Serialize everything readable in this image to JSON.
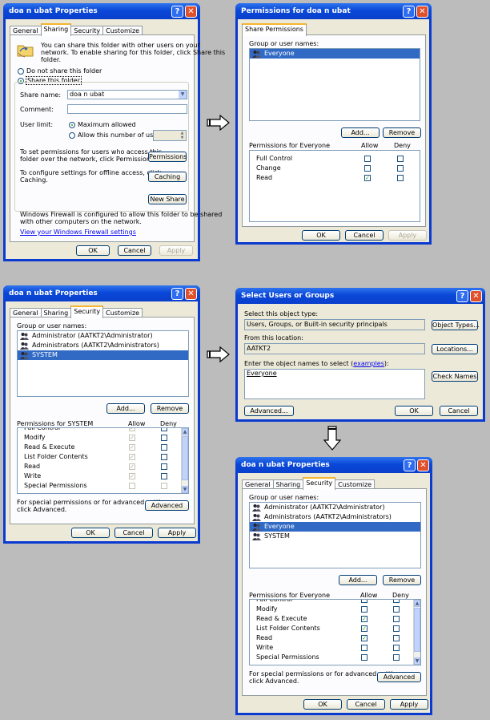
{
  "colors": {
    "title_bar": "#0a48d8",
    "dialog_bg": "#ece9d8",
    "selection": "#316ac5",
    "check": "#21a121",
    "desktop": "#bcbcbc"
  },
  "icons": [
    "help-icon",
    "close-icon",
    "folder-share-icon",
    "user-group-icon",
    "right-arrow-icon",
    "down-arrow-icon",
    "checkmark-icon"
  ],
  "sharing_dialog": {
    "title": "doa n ubat Properties",
    "tabs": [
      "General",
      "Sharing",
      "Security",
      "Customize"
    ],
    "intro": [
      "You can share this folder with other users on your",
      "network. To enable sharing for this folder, click Share this",
      "folder."
    ],
    "do_not_share": "Do not share this folder",
    "share_this": "Share this folder",
    "share_name_label": "Share name:",
    "share_name_value": "doa n ubat",
    "comment_label": "Comment:",
    "user_limit_label": "User limit:",
    "max_allowed": "Maximum allowed",
    "allow_users": "Allow this number of users:",
    "perm_text": [
      "To set permissions for users who access this",
      "folder over the network, click Permissions."
    ],
    "permissions_button": "Permissions",
    "cache_text": [
      "To configure settings for offline access, click",
      "Caching."
    ],
    "caching_button": "Caching",
    "new_share_button": "New Share",
    "firewall_text": [
      "Windows Firewall is configured to allow this folder to be shared",
      "with other computers on the network."
    ],
    "firewall_link": "View your Windows Firewall settings",
    "ok": "OK",
    "cancel": "Cancel",
    "apply": "Apply"
  },
  "share_perms_dialog": {
    "title": "Permissions for doa n ubat",
    "tab": "Share Permissions",
    "group_label": "Group or user names:",
    "users": [
      "Everyone"
    ],
    "add": "Add...",
    "remove": "Remove",
    "perm_header": "Permissions for Everyone",
    "allow": "Allow",
    "deny": "Deny",
    "perms": [
      {
        "name": "Full Control",
        "allow": false,
        "deny": false
      },
      {
        "name": "Change",
        "allow": false,
        "deny": false
      },
      {
        "name": "Read",
        "allow": true,
        "deny": false
      }
    ],
    "ok": "OK",
    "cancel": "Cancel",
    "apply": "Apply"
  },
  "security_dialog_1": {
    "title": "doa n ubat Properties",
    "tabs": [
      "General",
      "Sharing",
      "Security",
      "Customize"
    ],
    "group_label": "Group or user names:",
    "users": [
      "Administrator (AATKT2\\Administrator)",
      "Administrators (AATKT2\\Administrators)",
      "SYSTEM"
    ],
    "add": "Add...",
    "remove": "Remove",
    "perm_header": "Permissions for SYSTEM",
    "allow": "Allow",
    "deny": "Deny",
    "perms": [
      {
        "name": "Full Control",
        "allow": true,
        "deny": false
      },
      {
        "name": "Modify",
        "allow": true,
        "deny": false
      },
      {
        "name": "Read & Execute",
        "allow": true,
        "deny": false
      },
      {
        "name": "List Folder Contents",
        "allow": true,
        "deny": false
      },
      {
        "name": "Read",
        "allow": true,
        "deny": false
      },
      {
        "name": "Write",
        "allow": true,
        "deny": false
      },
      {
        "name": "Special Permissions",
        "allow": false,
        "deny": false
      }
    ],
    "special_text": [
      "For special permissions or for advanced settings,",
      "click Advanced."
    ],
    "advanced": "Advanced",
    "ok": "OK",
    "cancel": "Cancel",
    "apply": "Apply"
  },
  "select_users_dialog": {
    "title": "Select Users or Groups",
    "object_type_label": "Select this object type:",
    "object_type_value": "Users, Groups, or Built-in security principals",
    "object_types_button": "Object Types...",
    "location_label": "From this location:",
    "location_value": "AATKT2",
    "locations_button": "Locations...",
    "names_label": "Enter the object names to select",
    "examples_link": "examples",
    "names_value": "Everyone",
    "check_names": "Check Names",
    "advanced": "Advanced...",
    "ok": "OK",
    "cancel": "Cancel"
  },
  "security_dialog_2": {
    "title": "doa n ubat Properties",
    "tabs": [
      "General",
      "Sharing",
      "Security",
      "Customize"
    ],
    "group_label": "Group or user names:",
    "users": [
      "Administrator (AATKT2\\Administrator)",
      "Administrators (AATKT2\\Administrators)",
      "Everyone",
      "SYSTEM"
    ],
    "add": "Add...",
    "remove": "Remove",
    "perm_header": "Permissions for Everyone",
    "allow": "Allow",
    "deny": "Deny",
    "perms": [
      {
        "name": "Full Control",
        "allow": false,
        "deny": false
      },
      {
        "name": "Modify",
        "allow": false,
        "deny": false
      },
      {
        "name": "Read & Execute",
        "allow": true,
        "deny": false
      },
      {
        "name": "List Folder Contents",
        "allow": true,
        "deny": false
      },
      {
        "name": "Read",
        "allow": true,
        "deny": false
      },
      {
        "name": "Write",
        "allow": false,
        "deny": false
      },
      {
        "name": "Special Permissions",
        "allow": false,
        "deny": false
      }
    ],
    "special_text": [
      "For special permissions or for advanced settings,",
      "click Advanced."
    ],
    "advanced": "Advanced",
    "ok": "OK",
    "cancel": "Cancel",
    "apply": "Apply"
  }
}
